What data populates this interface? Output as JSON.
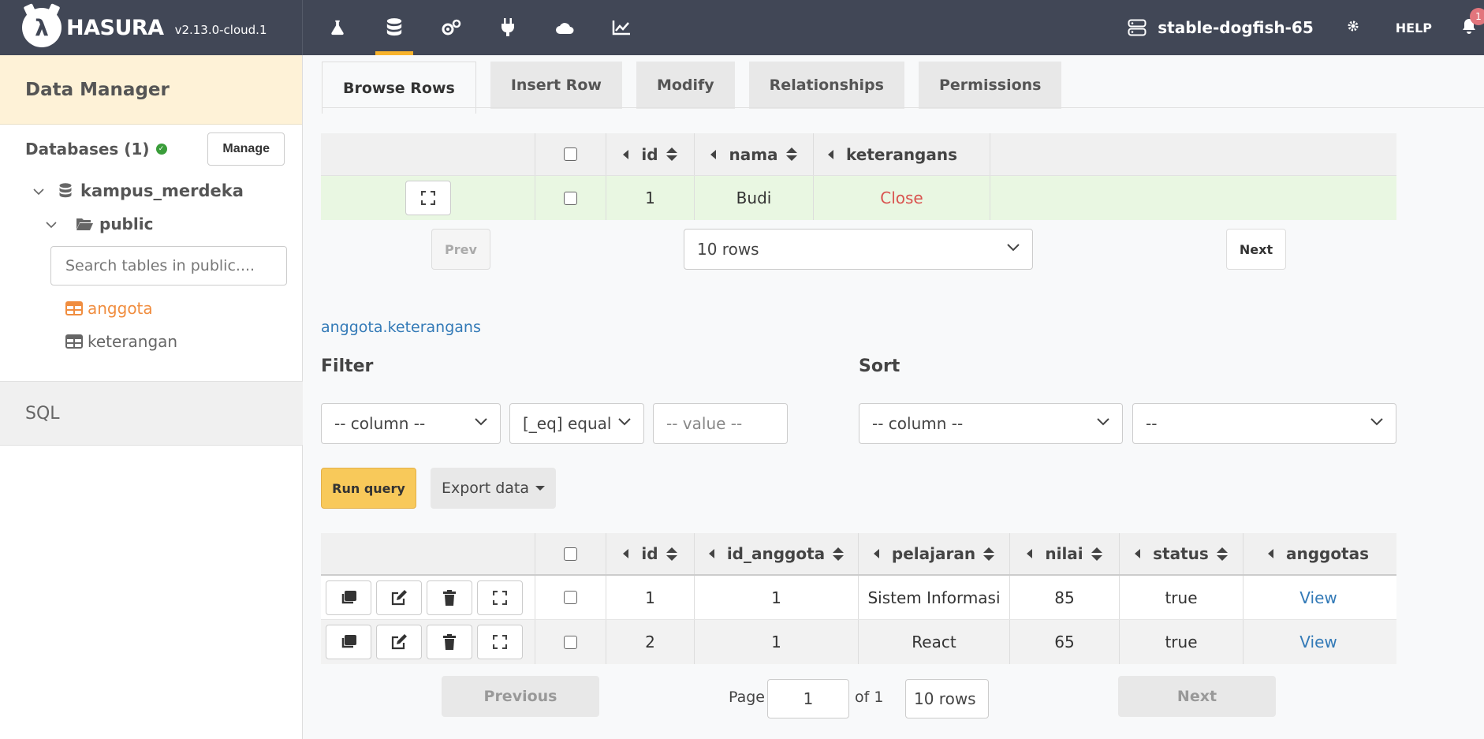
{
  "brand": {
    "name": "HASURA",
    "version": "v2.13.0-cloud.1"
  },
  "nav": {
    "icons": [
      "flask-icon",
      "database-icon",
      "actions-gear-icon",
      "remote-schema-plug-icon",
      "events-cloud-icon",
      "monitoring-chart-icon"
    ],
    "active_index": 1,
    "project_name": "stable-dogfish-65",
    "help_label": "HELP",
    "notification_count": "1"
  },
  "sidebar": {
    "title": "Data Manager",
    "databases_label": "Databases (1)",
    "manage_label": "Manage",
    "database_name": "kampus_merdeka",
    "schema_name": "public",
    "search_placeholder": "Search tables in public....",
    "tables": [
      "anggota",
      "keterangan"
    ],
    "active_table": "anggota",
    "sql_label": "SQL"
  },
  "tabs": [
    "Browse Rows",
    "Insert Row",
    "Modify",
    "Relationships",
    "Permissions"
  ],
  "active_tab": "Browse Rows",
  "main_table": {
    "columns": [
      "id",
      "nama",
      "keterangans"
    ],
    "rows": [
      {
        "id": "1",
        "nama": "Budi",
        "keterangans": "Close"
      }
    ],
    "prev_label": "Prev",
    "next_label": "Next",
    "rows_select": "10 rows"
  },
  "relationship": {
    "title": "anggota.keterangans",
    "filter_label": "Filter",
    "sort_label": "Sort",
    "filter_column": "-- column --",
    "filter_operator": "[_eq] equal",
    "filter_value_placeholder": "-- value --",
    "sort_column": "-- column --",
    "sort_order": "--",
    "run_query_label": "Run query",
    "export_label": "Export data"
  },
  "sub_table": {
    "columns": [
      "id",
      "id_anggota",
      "pelajaran",
      "nilai",
      "status",
      "anggotas"
    ],
    "rows": [
      {
        "id": "1",
        "id_anggota": "1",
        "pelajaran": "Sistem Informasi",
        "nilai": "85",
        "status": "true",
        "anggotas": "View"
      },
      {
        "id": "2",
        "id_anggota": "1",
        "pelajaran": "React",
        "nilai": "65",
        "status": "true",
        "anggotas": "View"
      }
    ],
    "previous_label": "Previous",
    "page_label": "Page",
    "page_value": "1",
    "of_label": "of 1",
    "rows_select": "10 rows",
    "next_label": "Next"
  },
  "colors": {
    "navbar": "#414756",
    "accent": "#f8b32b",
    "active_table": "#f08d3f",
    "link": "#337ab7",
    "close_text": "#d9534f",
    "row_highlight": "#e9f7e2"
  }
}
